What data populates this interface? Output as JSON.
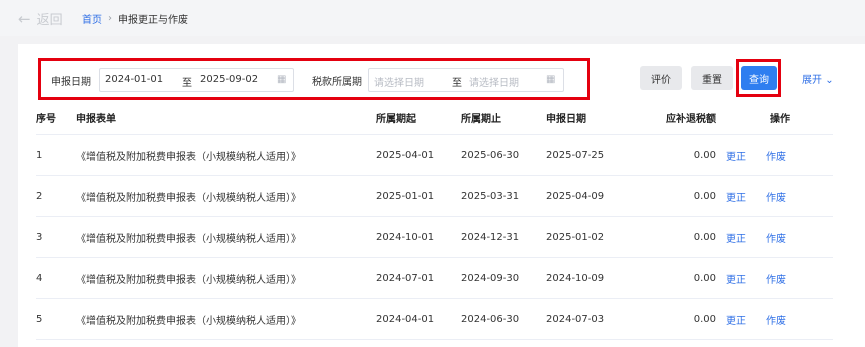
{
  "header": {
    "back_label": "返回",
    "breadcrumb": {
      "home": "首页",
      "separator": "›",
      "current": "申报更正与作废"
    }
  },
  "filters": {
    "declare_date_label": "申报日期",
    "declare_date_from": "2024-01-01",
    "to_label_1": "至",
    "declare_date_to": "2025-09-02",
    "tax_period_label": "税款所属期",
    "tax_period_from_placeholder": "请选择日期",
    "to_label_2": "至",
    "tax_period_to_placeholder": "请选择日期"
  },
  "actions": {
    "evaluate": "评价",
    "reset": "重置",
    "query": "查询",
    "expand": "展开"
  },
  "table": {
    "columns": [
      "序号",
      "申报表单",
      "所属期起",
      "所属期止",
      "申报日期",
      "应补退税额",
      "操作"
    ],
    "rows": [
      {
        "no": "1",
        "form": "《增值税及附加税费申报表（小规模纳税人适用）》",
        "start": "2025-04-01",
        "end": "2025-06-30",
        "date": "2025-07-25",
        "amount": "0.00",
        "correct": "更正",
        "void": "作废"
      },
      {
        "no": "2",
        "form": "《增值税及附加税费申报表（小规模纳税人适用）》",
        "start": "2025-01-01",
        "end": "2025-03-31",
        "date": "2025-04-09",
        "amount": "0.00",
        "correct": "更正",
        "void": "作废"
      },
      {
        "no": "3",
        "form": "《增值税及附加税费申报表（小规模纳税人适用）》",
        "start": "2024-10-01",
        "end": "2024-12-31",
        "date": "2025-01-02",
        "amount": "0.00",
        "correct": "更正",
        "void": "作废"
      },
      {
        "no": "4",
        "form": "《增值税及附加税费申报表（小规模纳税人适用）》",
        "start": "2024-07-01",
        "end": "2024-09-30",
        "date": "2024-10-09",
        "amount": "0.00",
        "correct": "更正",
        "void": "作废"
      },
      {
        "no": "5",
        "form": "《增值税及附加税费申报表（小规模纳税人适用）》",
        "start": "2024-04-01",
        "end": "2024-06-30",
        "date": "2024-07-03",
        "amount": "0.00",
        "correct": "更正",
        "void": "作废"
      }
    ]
  },
  "colors": {
    "primary": "#2f7ef0",
    "link": "#2f6fe6",
    "highlight": "#e4000f"
  }
}
